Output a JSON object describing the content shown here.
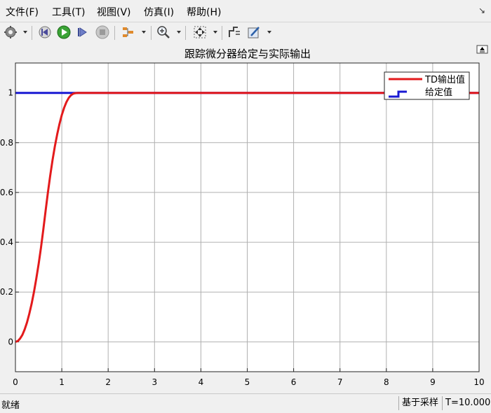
{
  "menu": [
    "文件(F)",
    "工具(T)",
    "视图(V)",
    "仿真(I)",
    "帮助(H)"
  ],
  "toolbar": {
    "icons": [
      "gear-icon",
      "step-back-icon",
      "run-icon",
      "step-forward-icon",
      "stop-icon",
      "signal-select-icon",
      "zoom-in-icon",
      "fit-to-view-icon",
      "cursor-measure-icon",
      "style-edit-icon"
    ]
  },
  "chart_data": {
    "type": "line",
    "title": "跟踪微分器给定与实际输出",
    "xlabel": "",
    "ylabel": "",
    "xlim": [
      0,
      10
    ],
    "ylim": [
      -0.12,
      1.12
    ],
    "xticks": [
      0,
      1,
      2,
      3,
      4,
      5,
      6,
      7,
      8,
      9,
      10
    ],
    "yticks": [
      0,
      0.2,
      0.4,
      0.6,
      0.8,
      1
    ],
    "grid": true,
    "legend": "top-right",
    "series": [
      {
        "name": "TD输出值",
        "color": "#e31a1c",
        "style": "line",
        "x": [
          0,
          0.05,
          0.1,
          0.15,
          0.2,
          0.25,
          0.3,
          0.35,
          0.4,
          0.45,
          0.5,
          0.55,
          0.6,
          0.65,
          0.7,
          0.75,
          0.8,
          0.85,
          0.9,
          0.95,
          1.0,
          1.05,
          1.1,
          1.15,
          1.2,
          1.25,
          1.3,
          1.35,
          1.4,
          1.45,
          10
        ],
        "y": [
          0,
          0.003,
          0.013,
          0.028,
          0.05,
          0.078,
          0.113,
          0.153,
          0.2,
          0.253,
          0.313,
          0.378,
          0.45,
          0.526,
          0.6,
          0.668,
          0.73,
          0.785,
          0.833,
          0.875,
          0.911,
          0.94,
          0.963,
          0.98,
          0.991,
          0.997,
          0.999,
          1.0,
          1.0,
          1.0,
          1.0
        ]
      },
      {
        "name": "给定值",
        "color": "#1919d2",
        "style": "step",
        "x": [
          0,
          10
        ],
        "y": [
          1,
          1
        ]
      }
    ]
  },
  "status": {
    "ready": "就绪",
    "mode": "基于采样",
    "time": "T=10.000"
  }
}
